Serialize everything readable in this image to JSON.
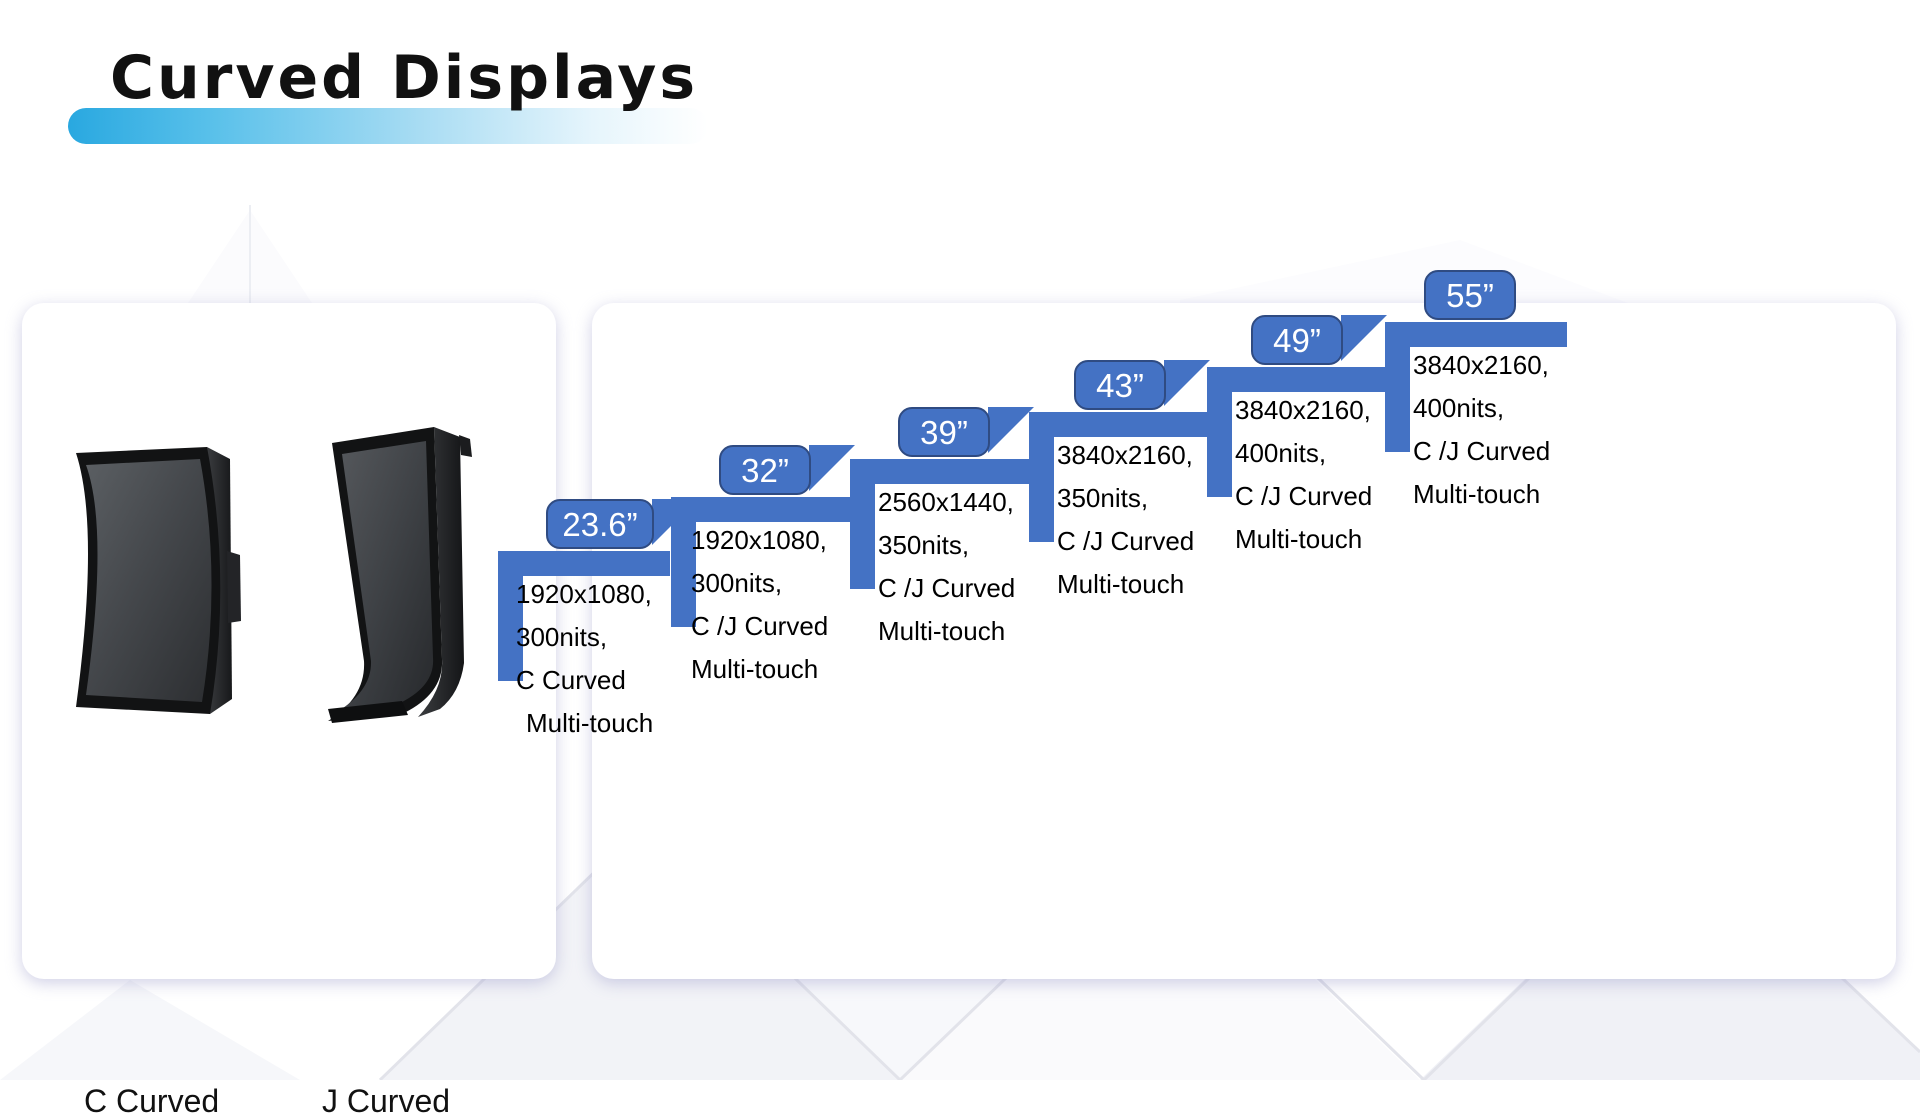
{
  "page": {
    "title": "Curved Displays",
    "accent_blue": "#4472c4",
    "badge_border": "#2f4b82",
    "title_bar_gradient_start": "#29a8e0",
    "title_bar_gradient_end": "#ffffff"
  },
  "left_panel": {
    "name": "curved-display-types",
    "items": [
      {
        "label": "C Curved",
        "icon": "c-curved-display-icon"
      },
      {
        "label": "J Curved",
        "icon": "j-curved-display-icon"
      }
    ]
  },
  "right_panel": {
    "name": "size-lineup",
    "steps": [
      {
        "size": "23.6”",
        "resolution": "1920x1080,",
        "brightness": "300nits,",
        "curve": "C Curved",
        "touch": "Multi-touch"
      },
      {
        "size": "32”",
        "resolution": "1920x1080,",
        "brightness": "300nits,",
        "curve": "C /J Curved",
        "touch": "Multi-touch"
      },
      {
        "size": "39”",
        "resolution": "2560x1440,",
        "brightness": "350nits,",
        "curve": "C /J  Curved",
        "touch": "Multi-touch"
      },
      {
        "size": "43”",
        "resolution": "3840x2160,",
        "brightness": "350nits,",
        "curve": "C /J  Curved",
        "touch": "Multi-touch"
      },
      {
        "size": "49”",
        "resolution": "3840x2160,",
        "brightness": "400nits,",
        "curve": "C /J  Curved",
        "touch": "Multi-touch"
      },
      {
        "size": "55”",
        "resolution": "3840x2160,",
        "brightness": "400nits,",
        "curve": "C /J  Curved",
        "touch": "Multi-touch"
      }
    ]
  }
}
